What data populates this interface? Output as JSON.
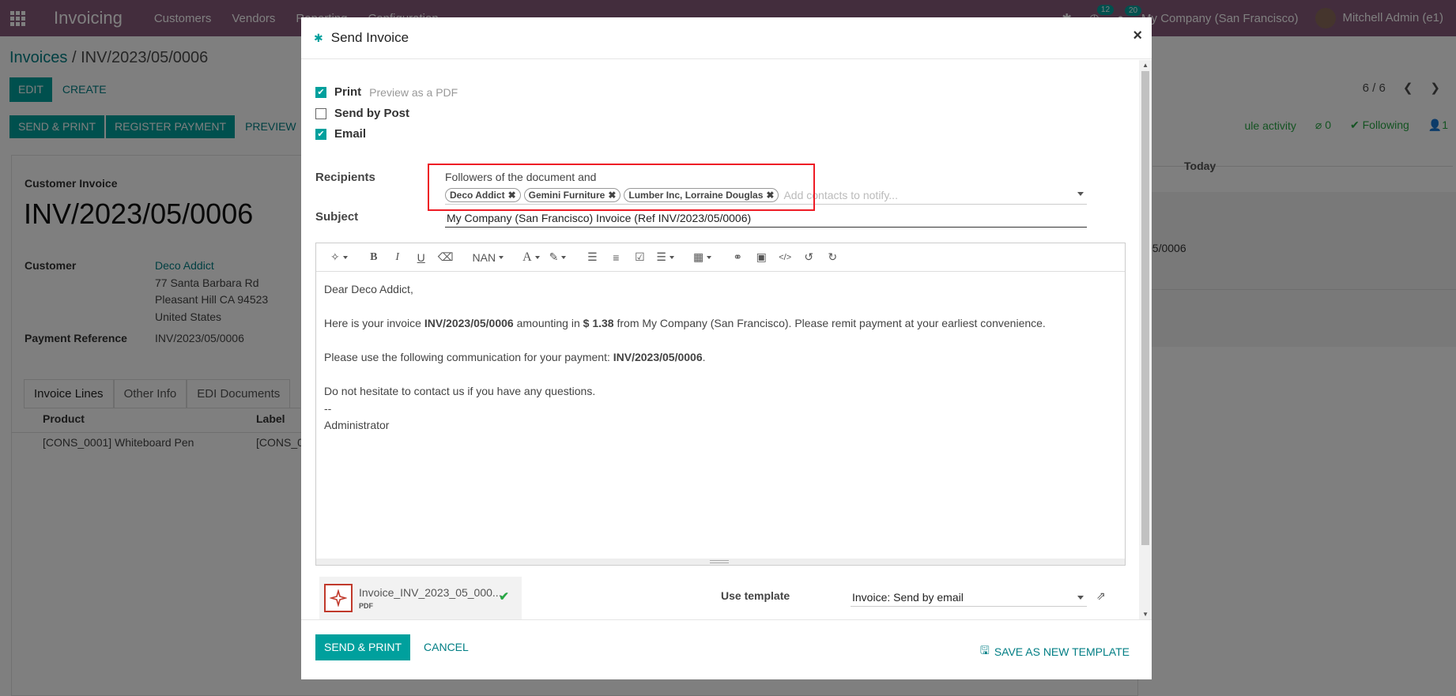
{
  "navbar": {
    "app_name": "Invoicing",
    "menu": [
      "Customers",
      "Vendors",
      "Reporting",
      "Configuration"
    ],
    "activity_count": "12",
    "message_count": "20",
    "company": "My Company (San Francisco)",
    "user": "Mitchell Admin (e1)"
  },
  "page": {
    "breadcrumb_parent": "Invoices",
    "breadcrumb_sep": "/",
    "breadcrumb_current": "INV/2023/05/0006",
    "edit_label": "EDIT",
    "create_label": "CREATE",
    "status_buttons": [
      "SEND & PRINT",
      "REGISTER PAYMENT",
      "PREVIEW"
    ],
    "pager": "6 / 6",
    "doc_type": "Customer Invoice",
    "doc_name": "INV/2023/05/0006",
    "customer_label": "Customer",
    "customer_name": "Deco Addict",
    "address_line1": "77 Santa Barbara Rd",
    "address_line2": "Pleasant Hill CA 94523",
    "address_line3": "United States",
    "payment_ref_label": "Payment Reference",
    "payment_ref_value": "INV/2023/05/0006",
    "tabs": [
      "Invoice Lines",
      "Other Info",
      "EDI Documents"
    ],
    "col_product": "Product",
    "col_label": "Label",
    "row_product": "[CONS_0001] Whiteboard Pen",
    "row_label": "[CONS_0"
  },
  "chatter": {
    "schedule_activity": "ule activity",
    "attachments_count": "0",
    "following_label": "Following",
    "followers_count": "1",
    "today_label": "Today",
    "ref": "05/0006"
  },
  "modal": {
    "title": "Send Invoice",
    "print_label": "Print",
    "print_hint": "Preview as a PDF",
    "send_by_post_label": "Send by Post",
    "email_label": "Email",
    "recipients_label": "Recipients",
    "recipients_text": "Followers of the document and",
    "tags": [
      "Deco Addict",
      "Gemini Furniture",
      "Lumber Inc, Lorraine Douglas"
    ],
    "tags_placeholder": "Add contacts to notify...",
    "subject_label": "Subject",
    "subject_value": "My Company (San Francisco) Invoice (Ref INV/2023/05/0006)",
    "toolbar_font_size": "NAN",
    "body": {
      "greeting": "Dear Deco Addict,",
      "line1_pre": "Here is your invoice ",
      "line1_inv": "INV/2023/05/0006",
      "line1_mid": " amounting in ",
      "line1_amount": "$ 1.38",
      "line1_post": " from My Company (San Francisco). Please remit payment at your earliest convenience.",
      "line2_pre": "Please use the following communication for your payment: ",
      "line2_ref": "INV/2023/05/0006",
      "line2_post": ".",
      "line3": "Do not hesitate to contact us if you have any questions.",
      "sig_sep": "--",
      "signature": "Administrator"
    },
    "attachment_name": "Invoice_INV_2023_05_000...",
    "attachment_type": "PDF",
    "use_template_label": "Use template",
    "template_value": "Invoice: Send by email",
    "send_print_label": "SEND & PRINT",
    "cancel_label": "CANCEL",
    "save_template_label": "SAVE AS NEW TEMPLATE"
  },
  "colors": {
    "navbar": "#875a7b",
    "primary": "#00a09d",
    "link": "#017e84",
    "highlight": "#ee1c25"
  }
}
